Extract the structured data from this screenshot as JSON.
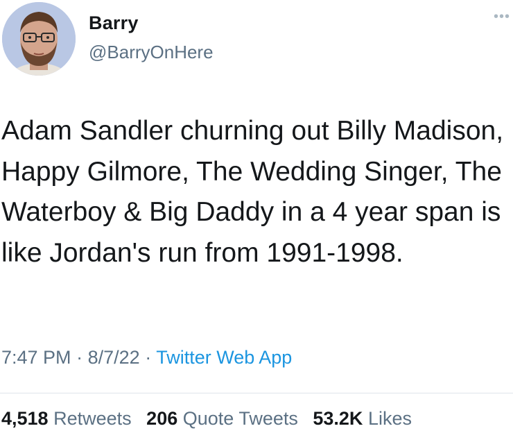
{
  "author": {
    "name": "Barry",
    "handle": "@BarryOnHere"
  },
  "menu_icon": "more-dots-icon",
  "tweet_text": "Adam Sandler churning out Billy Madison, Happy Gilmore, The Wedding Singer, The Waterboy & Big Daddy in a 4 year span is like Jordan's run from 1991-1998.",
  "meta": {
    "time": "7:47 PM",
    "date": "8/7/22",
    "separator": "·",
    "app": "Twitter Web App"
  },
  "stats": {
    "retweets_count": "4,518",
    "retweets_label": "Retweets",
    "quotes_count": "206",
    "quotes_label": "Quote Tweets",
    "likes_count": "53.2K",
    "likes_label": "Likes"
  },
  "colors": {
    "text": "#14171a",
    "secondary": "#5b7083",
    "link": "#1b95e0",
    "divider": "#dfe5ea"
  }
}
